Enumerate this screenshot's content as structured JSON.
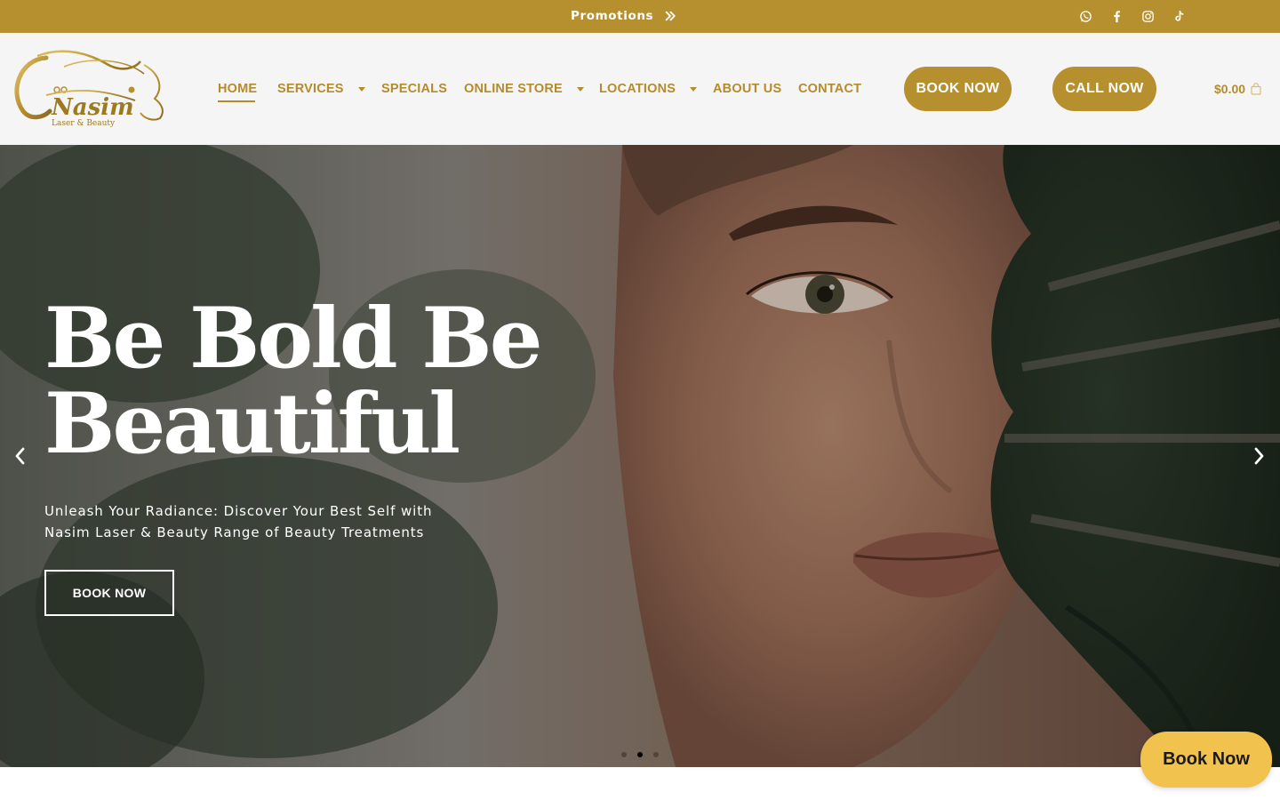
{
  "colors": {
    "brand_gold": "#B68F2E",
    "nav_text": "#B58B2C",
    "header_bg": "#f5f5f5",
    "float_button_bg": "#F1C24D",
    "hero_text": "#ffffff"
  },
  "promo_bar": {
    "label": "Promotions",
    "icon": "double-chevron-right-icon",
    "social_icons": [
      "whatsapp-icon",
      "facebook-icon",
      "instagram-icon",
      "tiktok-icon"
    ]
  },
  "header": {
    "logo": {
      "name": "Nasim",
      "tagline": "Laser & Beauty"
    },
    "nav": [
      {
        "label": "HOME",
        "active": true,
        "has_dropdown": false
      },
      {
        "label": "SERVICES",
        "active": false,
        "has_dropdown": true
      },
      {
        "label": "SPECIALS",
        "active": false,
        "has_dropdown": false
      },
      {
        "label": "ONLINE STORE",
        "active": false,
        "has_dropdown": true
      },
      {
        "label": "LOCATIONS",
        "active": false,
        "has_dropdown": true
      },
      {
        "label": "ABOUT US",
        "active": false,
        "has_dropdown": false
      },
      {
        "label": "CONTACT",
        "active": false,
        "has_dropdown": false
      }
    ],
    "book_now_label": "BOOK NOW",
    "call_now_label": "CALL NOW",
    "cart_total": "$0.00",
    "cart_icon": "shopping-bag-icon"
  },
  "hero": {
    "title_line1": "Be Bold Be",
    "title_line2": "Beautiful",
    "subtitle_line1": "Unleash Your Radiance: Discover Your Best Self with",
    "subtitle_line2": "Nasim Laser & Beauty Range of Beauty Treatments",
    "cta_label": "BOOK NOW",
    "prev_icon": "chevron-left-icon",
    "next_icon": "chevron-right-icon",
    "slide_count": 3,
    "active_slide": 2
  },
  "floating_button": {
    "label": "Book Now"
  }
}
